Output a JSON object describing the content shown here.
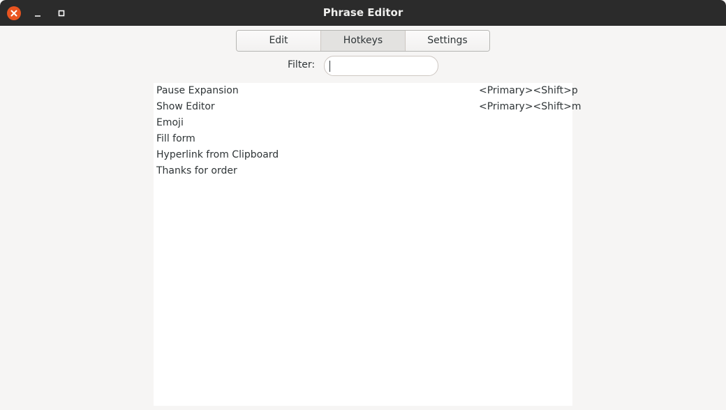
{
  "window": {
    "title": "Phrase Editor"
  },
  "tabs": [
    {
      "label": "Edit",
      "active": false
    },
    {
      "label": "Hotkeys",
      "active": true
    },
    {
      "label": "Settings",
      "active": false
    }
  ],
  "filter": {
    "label": "Filter:",
    "value": ""
  },
  "phrases": [
    {
      "name": "Pause Expansion",
      "hotkey": "<Primary><Shift>p"
    },
    {
      "name": "Show Editor",
      "hotkey": "<Primary><Shift>m"
    },
    {
      "name": "Emoji",
      "hotkey": ""
    },
    {
      "name": "Fill form",
      "hotkey": ""
    },
    {
      "name": "Hyperlink from Clipboard",
      "hotkey": ""
    },
    {
      "name": "Thanks for order",
      "hotkey": ""
    }
  ],
  "colors": {
    "titlebar": "#2b2b2b",
    "close_button": "#e95420"
  }
}
